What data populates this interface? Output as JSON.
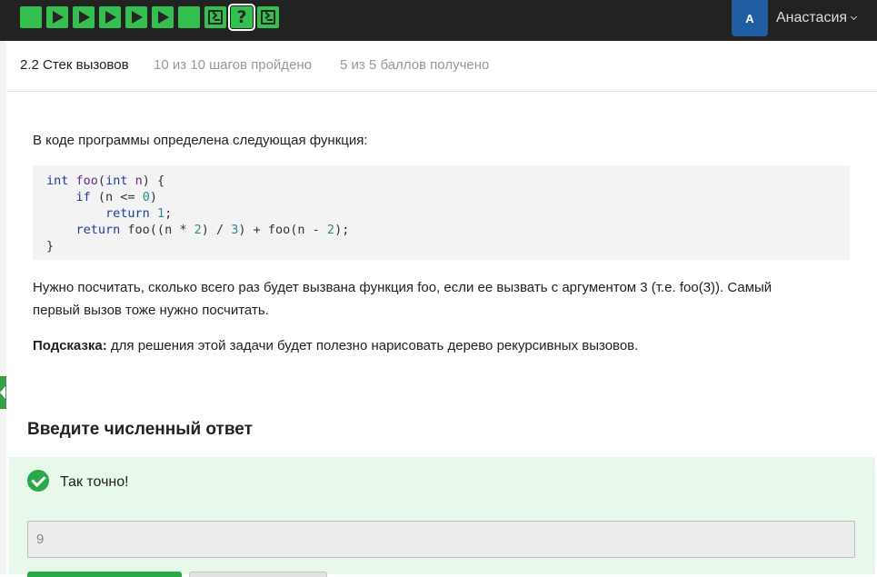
{
  "topbar": {
    "steps": [
      {
        "type": "square",
        "state": "passed"
      },
      {
        "type": "play",
        "state": "passed"
      },
      {
        "type": "play",
        "state": "passed"
      },
      {
        "type": "play",
        "state": "passed"
      },
      {
        "type": "play",
        "state": "passed"
      },
      {
        "type": "play",
        "state": "passed"
      },
      {
        "type": "square",
        "state": "passed"
      },
      {
        "type": "terminal",
        "state": "passed"
      },
      {
        "type": "question",
        "state": "current",
        "symbol": "?"
      },
      {
        "type": "terminal",
        "state": "passed"
      }
    ],
    "user": {
      "initial": "А",
      "name": "Анастасия"
    }
  },
  "header": {
    "lesson_title": "2.2 Стек вызовов",
    "progress": "10 из 10 шагов пройдено",
    "score": "5 из 5 баллов  получено"
  },
  "content": {
    "intro": "В коде программы определена следующая функция:",
    "code_lines": [
      "int foo(int n) {",
      "    if (n <= 0)",
      "        return 1;",
      "    return foo((n * 2) / 3) + foo(n - 2);",
      "}"
    ],
    "question_line1": "Нужно посчитать, сколько всего раз будет вызвана функция foo, если ее вызвать с аргументом 3 (т.е. foo(3)). Самый",
    "question_line2": "первый вызов тоже нужно посчитать.",
    "hint_label": "Подсказка:",
    "hint_text": " для решения этой задачи будет полезно нарисовать дерево рекурсивных вызовов."
  },
  "answer": {
    "title": "Введите численный ответ",
    "feedback": "Так точно!",
    "value": "9"
  },
  "colors": {
    "accent_green": "#33c04f",
    "topbar_bg": "#222222",
    "feedback_bg": "#e8f8ea",
    "avatar_bg": "#1f5ea0"
  }
}
